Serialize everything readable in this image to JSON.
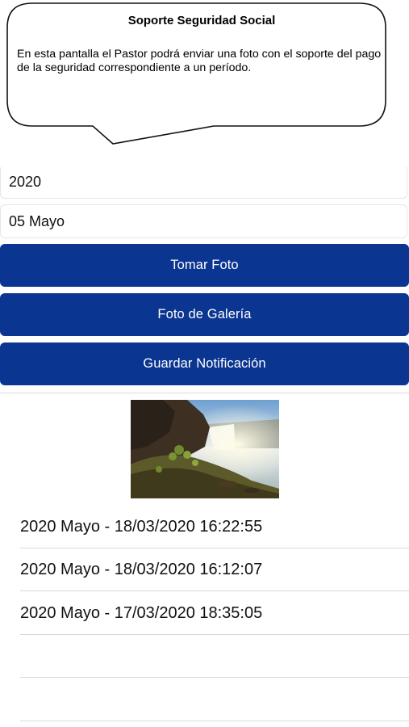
{
  "bubble": {
    "title": "Soporte Seguridad Social",
    "text": "En esta pantalla el Pastor podrá enviar una foto con el soporte del pago de la seguridad correspondiente a un período."
  },
  "form": {
    "year_value": "2020",
    "month_value": "05 Mayo"
  },
  "buttons": {
    "take_photo": "Tomar Foto",
    "gallery_photo": "Foto de Galería",
    "save_notification": "Guardar Notificación"
  },
  "colors": {
    "button_bg": "#0a3591",
    "button_text": "#ffffff"
  },
  "image": {
    "icon": "waterfall-landscape-photo"
  },
  "notifications": [
    "2020 Mayo - 18/03/2020 16:22:55",
    "2020 Mayo - 18/03/2020 16:12:07",
    "2020 Mayo - 17/03/2020 18:35:05",
    "",
    ""
  ]
}
